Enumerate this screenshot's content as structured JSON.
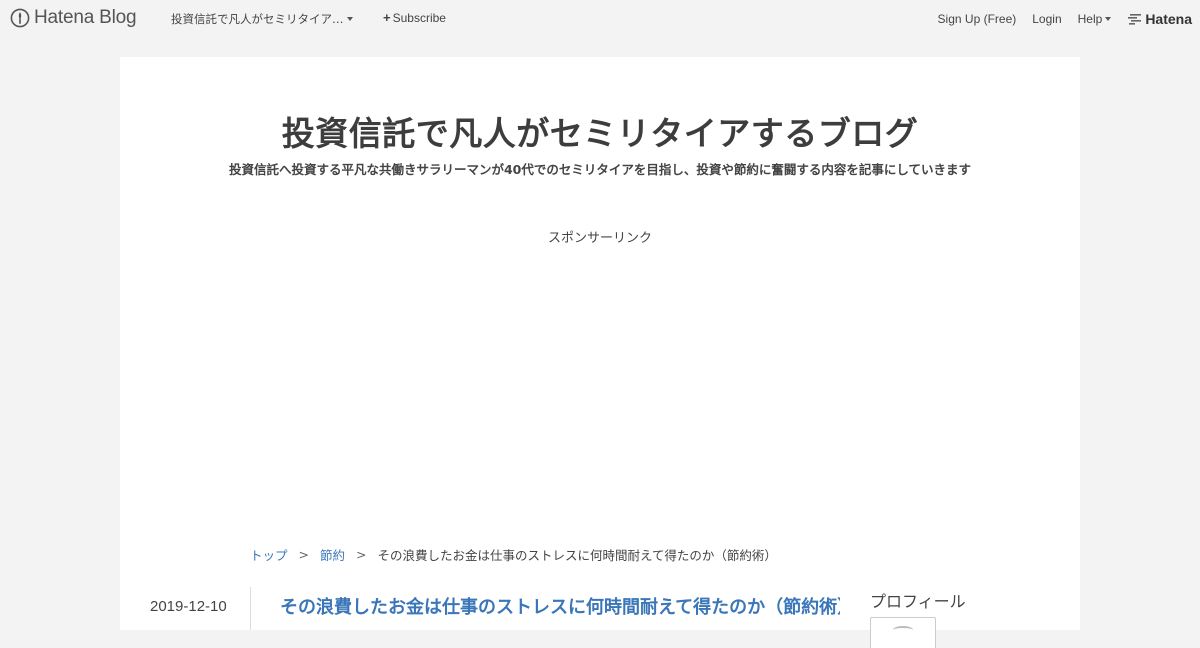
{
  "toolbar": {
    "brand_label": "Hatena Blog",
    "blog_name": "投資信託で凡人がセミリタイア…",
    "subscribe_label": "Subscribe",
    "signup_label": "Sign Up (Free)",
    "login_label": "Login",
    "help_label": "Help",
    "hatena_label": "Hatena"
  },
  "header": {
    "title": "投資信託で凡人がセミリタイアするブログ",
    "description": "投資信託へ投資する平凡な共働きサラリーマンが40代でのセミリタイアを目指し、投資や節約に奮闘する内容を記事にしていきます"
  },
  "sponsor": {
    "label": "スポンサーリンク"
  },
  "breadcrumb": {
    "items": [
      "トップ",
      "節約",
      "その浪費したお金は仕事のストレスに何時間耐えて得たのか（節約術）"
    ],
    "separator": ">"
  },
  "entry": {
    "date": "2019-12-10",
    "title": "その浪費したお金は仕事のストレスに何時間耐えて得たのか（節約術）"
  },
  "sidebar": {
    "profile_heading": "プロフィール"
  },
  "icons": {
    "logo": "hatena-blog-logo-icon",
    "dropdown": "chevron-down-icon",
    "subscribe": "plus-icon",
    "brand": "hatena-logo-icon",
    "avatar": "avatar-icon"
  }
}
